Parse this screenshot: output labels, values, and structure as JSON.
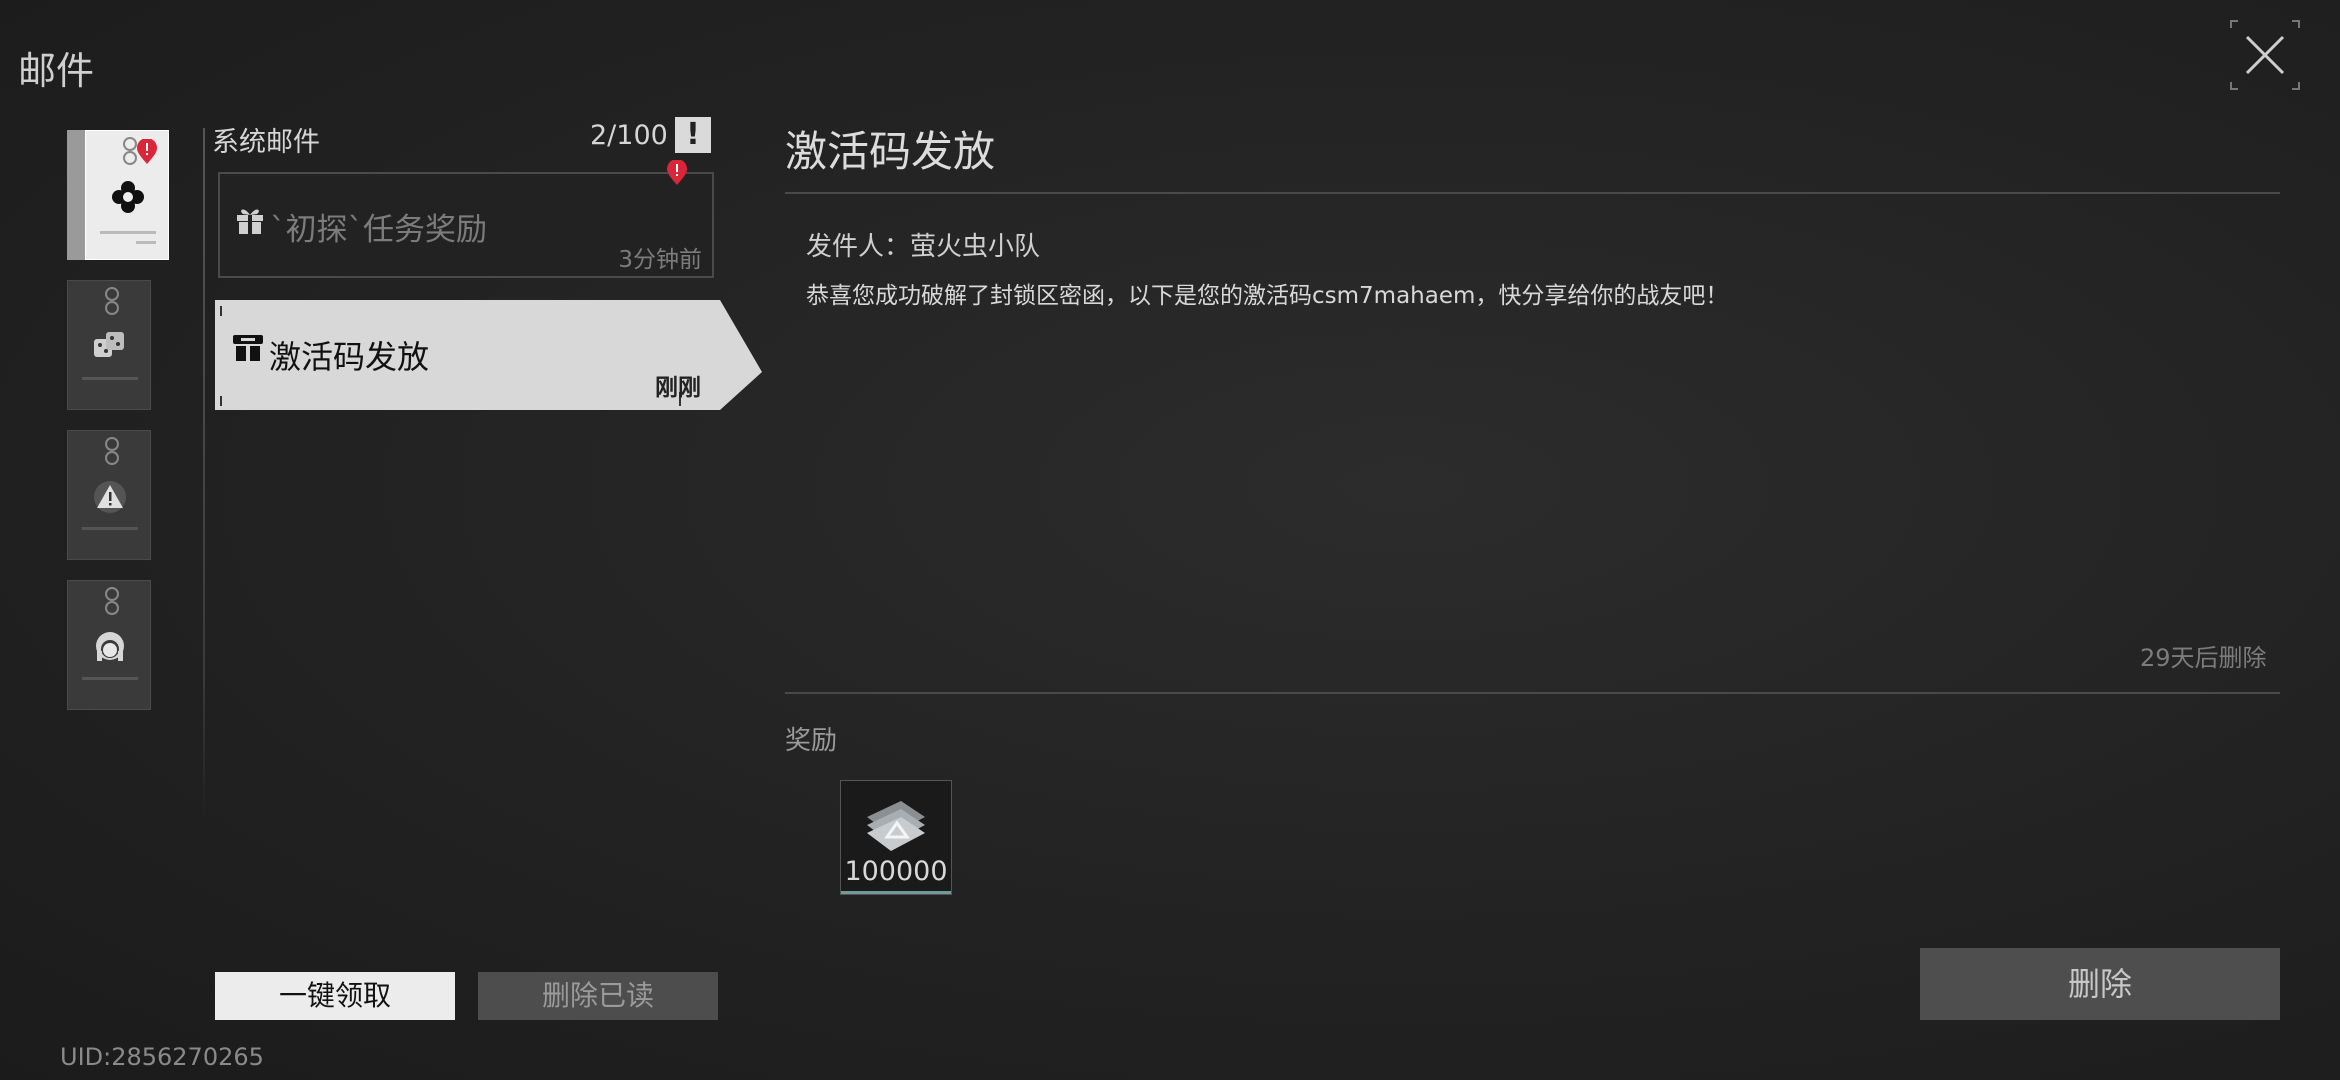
{
  "title": "邮件",
  "uid": "UID:2856270265",
  "list": {
    "header": "系统邮件",
    "count": "2/100",
    "mails": [
      {
        "icon": "gift-icon",
        "subject": "`初探`任务奖励",
        "time": "3分钟前",
        "unread": true
      },
      {
        "icon": "giftbox-icon",
        "subject": "激活码发放",
        "time": "刚刚",
        "selected": true
      }
    ]
  },
  "categories": [
    {
      "icon": "flower-icon",
      "active": true,
      "badge": true
    },
    {
      "icon": "dice-icon"
    },
    {
      "icon": "warning-icon"
    },
    {
      "icon": "girl-face-icon"
    }
  ],
  "buttons": {
    "claim_all": "一键领取",
    "delete_read": "删除已读",
    "delete": "删除"
  },
  "detail": {
    "title": "激活码发放",
    "sender": "发件人：萤火虫小队",
    "body": "恭喜您成功破解了封锁区密函，以下是您的激活码csm7mahaem，快分享给你的战友吧！",
    "expire": "29天后删除",
    "reward_label": "奖励",
    "reward": {
      "icon": "currency-stack-icon",
      "quantity": "100000"
    }
  },
  "colors": {
    "background": "#222222",
    "badge_red": "#d9263a",
    "selected_bg": "#d8d8d8"
  }
}
